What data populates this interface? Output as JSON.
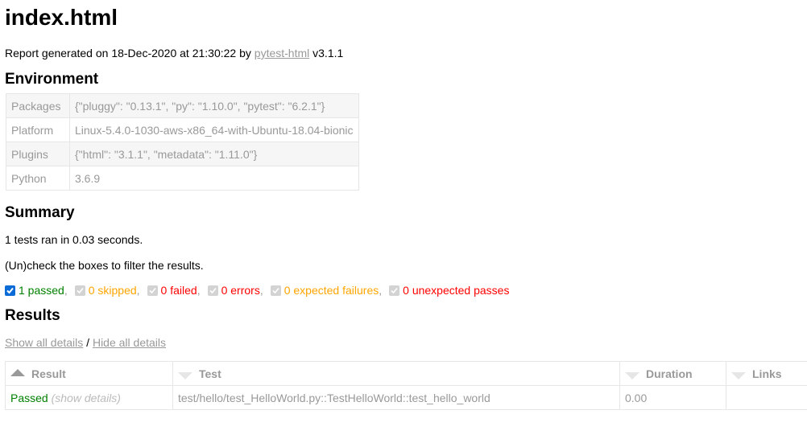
{
  "title": "index.html",
  "report": {
    "prefix": "Report generated on 18-Dec-2020 at 21:30:22 by ",
    "link": "pytest-html",
    "suffix": " v3.1.1"
  },
  "environment": {
    "heading": "Environment",
    "rows": [
      {
        "key": "Packages",
        "value": "{\"pluggy\": \"0.13.1\", \"py\": \"1.10.0\", \"pytest\": \"6.2.1\"}"
      },
      {
        "key": "Platform",
        "value": "Linux-5.4.0-1030-aws-x86_64-with-Ubuntu-18.04-bionic"
      },
      {
        "key": "Plugins",
        "value": "{\"html\": \"3.1.1\", \"metadata\": \"1.11.0\"}"
      },
      {
        "key": "Python",
        "value": "3.6.9"
      }
    ]
  },
  "summary": {
    "heading": "Summary",
    "ran": "1 tests ran in 0.03 seconds.",
    "hint": "(Un)check the boxes to filter the results.",
    "filters": [
      {
        "label": "1 passed",
        "checked": true,
        "enabled": true,
        "class": "passed"
      },
      {
        "label": "0 skipped",
        "checked": true,
        "enabled": false,
        "class": "skipped"
      },
      {
        "label": "0 failed",
        "checked": true,
        "enabled": false,
        "class": "failed"
      },
      {
        "label": "0 errors",
        "checked": true,
        "enabled": false,
        "class": "error"
      },
      {
        "label": "0 expected failures",
        "checked": true,
        "enabled": false,
        "class": "xfailed"
      },
      {
        "label": "0 unexpected passes",
        "checked": true,
        "enabled": false,
        "class": "xpassed"
      }
    ],
    "separator": ","
  },
  "results": {
    "heading": "Results",
    "show_all": "Show all details",
    "slash": " / ",
    "hide_all": "Hide all details",
    "columns": [
      {
        "label": "Result",
        "sort": "asc"
      },
      {
        "label": "Test",
        "sort": "desc"
      },
      {
        "label": "Duration",
        "sort": "desc"
      },
      {
        "label": "Links",
        "sort": "desc"
      }
    ],
    "rows": [
      {
        "result": "Passed",
        "show_details": "(show details)",
        "test": "test/hello/test_HelloWorld.py::TestHelloWorld::test_hello_world",
        "duration": "0.00",
        "links": ""
      }
    ]
  }
}
